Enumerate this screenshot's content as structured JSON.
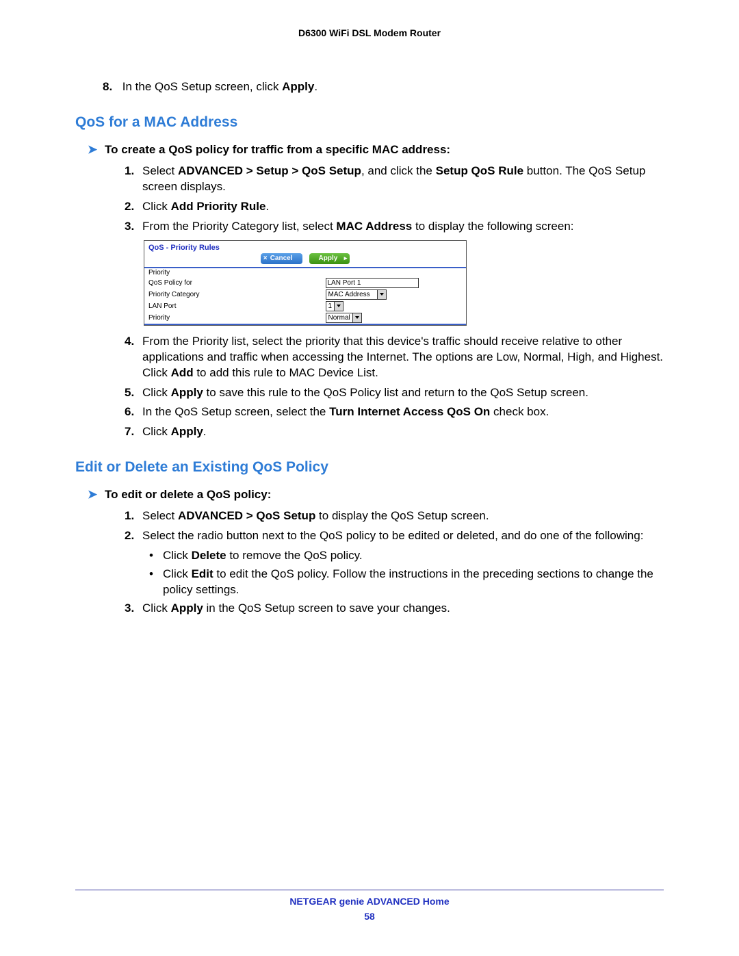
{
  "header": {
    "product": "D6300 WiFi DSL Modem Router"
  },
  "step8": {
    "num": "8.",
    "pre": "In the QoS Setup screen, click ",
    "bold": "Apply",
    "post": "."
  },
  "sectionA": {
    "title": "QoS for a MAC Address",
    "lead": "To create a QoS policy for traffic from a specific MAC address:",
    "s1": {
      "num": "1.",
      "a": "Select ",
      "b1": "ADVANCED > Setup > QoS Setup",
      "c": ", and click the ",
      "b2": "Setup QoS Rule",
      "d": " button. The QoS Setup screen displays."
    },
    "s2": {
      "num": "2.",
      "a": "Click ",
      "b": "Add Priority Rule",
      "c": "."
    },
    "s3": {
      "num": "3.",
      "a": "From the Priority Category list, select ",
      "b": "MAC Address",
      "c": " to display the following screen:"
    },
    "s4": {
      "num": "4.",
      "a": "From the Priority list, select the priority that this device's traffic should receive relative to other applications and traffic when accessing the Internet. The options are Low, Normal, High, and Highest. Click ",
      "b": "Add",
      "c": " to add this rule to MAC Device List."
    },
    "s5": {
      "num": "5.",
      "a": "Click ",
      "b": "Apply",
      "c": " to save this rule to the QoS Policy list and return to the QoS Setup screen."
    },
    "s6": {
      "num": "6.",
      "a": "In the QoS Setup screen, select the ",
      "b": "Turn Internet Access QoS On",
      "c": " check box."
    },
    "s7": {
      "num": "7.",
      "a": "Click ",
      "b": "Apply",
      "c": "."
    }
  },
  "screenshot": {
    "title": "QoS - Priority Rules",
    "cancel": "Cancel",
    "apply": "Apply",
    "rows": {
      "priority_label": "Priority",
      "policy_label": "QoS Policy for",
      "policy_value": "LAN Port 1",
      "category_label": "Priority Category",
      "category_value": "MAC Address",
      "lanport_label": "LAN Port",
      "lanport_value": "1",
      "priority2_label": "Priority",
      "priority2_value": "Normal"
    }
  },
  "sectionB": {
    "title": "Edit or Delete an Existing QoS Policy",
    "lead": "To edit or delete a QoS policy:",
    "s1": {
      "num": "1.",
      "a": "Select ",
      "b": "ADVANCED > QoS Setup",
      "c": " to display the QoS Setup screen."
    },
    "s2": {
      "num": "2.",
      "a": "Select the radio button next to the QoS policy to be edited or deleted, and do one of the following:"
    },
    "b1": {
      "dot": "•",
      "a": "Click ",
      "b": "Delete",
      "c": " to remove the QoS policy."
    },
    "b2": {
      "dot": "•",
      "a": "Click ",
      "b": "Edit",
      "c": " to edit the QoS policy. Follow the instructions in the preceding sections to change the policy settings."
    },
    "s3": {
      "num": "3.",
      "a": "Click ",
      "b": "Apply",
      "c": " in the QoS Setup screen to save your changes."
    }
  },
  "footer": {
    "title": "NETGEAR genie ADVANCED Home",
    "page": "58"
  }
}
